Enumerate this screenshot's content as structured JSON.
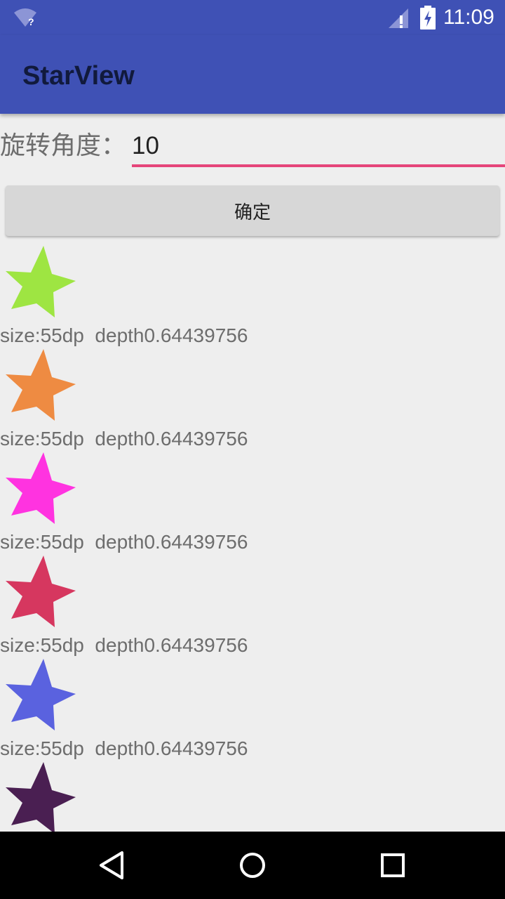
{
  "status_bar": {
    "time": "11:09",
    "wifi_icon": "wifi-unknown-icon",
    "signal_icon": "signal-no-service-icon",
    "battery_icon": "battery-charging-icon"
  },
  "app_bar": {
    "title": "StarView",
    "background_color": "#3f51b5"
  },
  "rotation": {
    "label": "旋转角度：",
    "value": "10",
    "underline_color": "#e5457a"
  },
  "confirm_button": {
    "label": "确定"
  },
  "stars": [
    {
      "color": "#9ee542",
      "caption": "size:55dp  depth0.64439756"
    },
    {
      "color": "#ee8b42",
      "caption": "size:55dp  depth0.64439756"
    },
    {
      "color": "#ff33e0",
      "caption": "size:55dp  depth0.64439756"
    },
    {
      "color": "#d6375f",
      "caption": "size:55dp  depth0.64439756"
    },
    {
      "color": "#5a62df",
      "caption": "size:55dp  depth0.64439756"
    },
    {
      "color": "#4a1f52",
      "caption": ""
    }
  ],
  "nav_bar": {
    "back_icon": "back-triangle-icon",
    "home_icon": "home-circle-icon",
    "recents_icon": "recents-square-icon"
  }
}
